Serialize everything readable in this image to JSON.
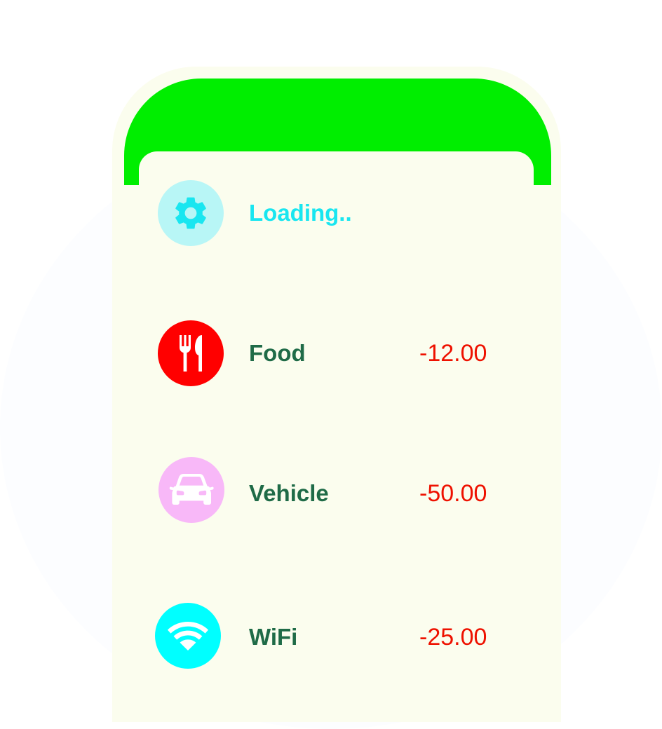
{
  "colors": {
    "header": "#00ee00",
    "card_bg": "#fbfdee",
    "label_text": "#1f6b47",
    "amount_text": "#ee1100",
    "loading_text": "#19e6f0"
  },
  "items": [
    {
      "label": "Loading..",
      "amount": "",
      "icon": "gear-icon",
      "icon_bg": "#b8f6f6",
      "icon_fg": "#19e6f0"
    },
    {
      "label": "Food",
      "amount": "-12.00",
      "icon": "fork-knife-icon",
      "icon_bg": "#ff0000",
      "icon_fg": "#ffffff"
    },
    {
      "label": "Vehicle",
      "amount": "-50.00",
      "icon": "car-icon",
      "icon_bg": "#f8b8f8",
      "icon_fg": "#ffffff"
    },
    {
      "label": "WiFi",
      "amount": "-25.00",
      "icon": "wifi-icon",
      "icon_bg": "#00ffff",
      "icon_fg": "#ffffff"
    }
  ]
}
